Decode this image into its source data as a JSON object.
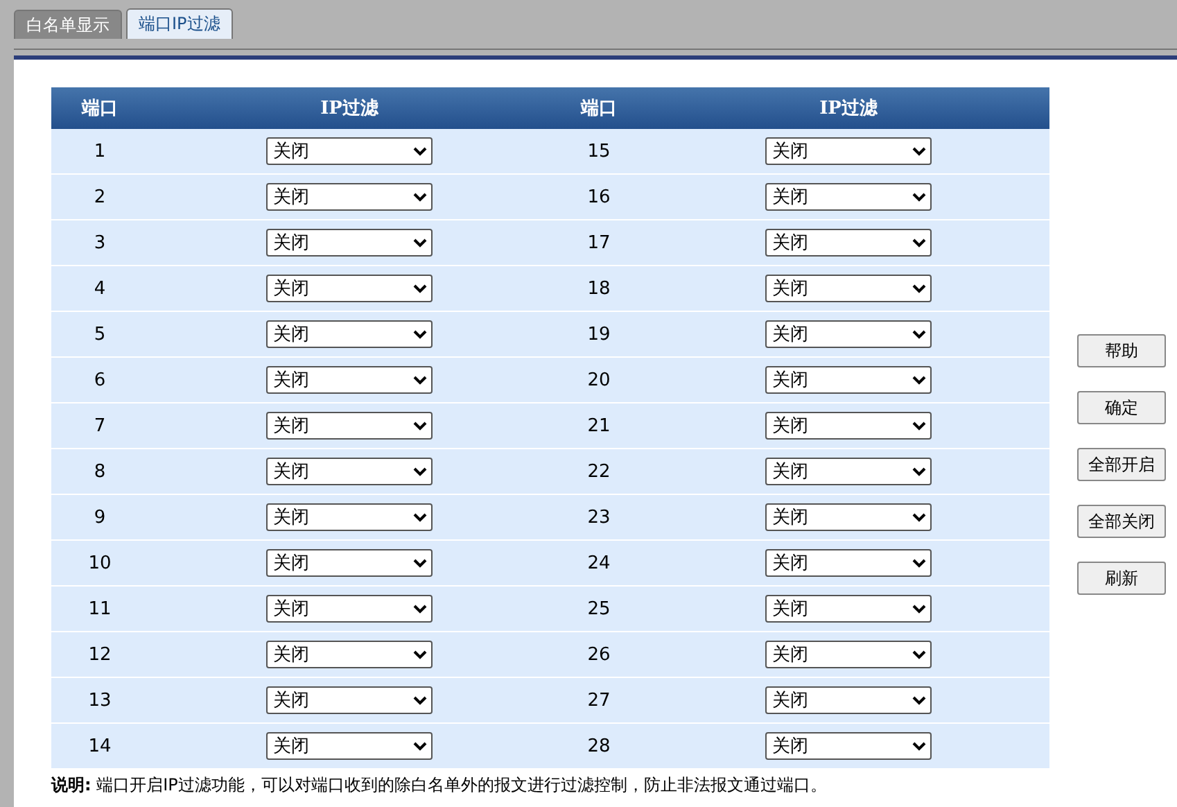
{
  "tabs": [
    {
      "label": "白名单显示",
      "selected": false
    },
    {
      "label": "端口IP过滤",
      "selected": true
    }
  ],
  "table": {
    "columns": [
      "端口",
      "IP过滤",
      "端口",
      "IP过滤"
    ],
    "rows": [
      {
        "port_a": "1",
        "filter_a": "关闭",
        "port_b": "15",
        "filter_b": "关闭"
      },
      {
        "port_a": "2",
        "filter_a": "关闭",
        "port_b": "16",
        "filter_b": "关闭"
      },
      {
        "port_a": "3",
        "filter_a": "关闭",
        "port_b": "17",
        "filter_b": "关闭"
      },
      {
        "port_a": "4",
        "filter_a": "关闭",
        "port_b": "18",
        "filter_b": "关闭"
      },
      {
        "port_a": "5",
        "filter_a": "关闭",
        "port_b": "19",
        "filter_b": "关闭"
      },
      {
        "port_a": "6",
        "filter_a": "关闭",
        "port_b": "20",
        "filter_b": "关闭"
      },
      {
        "port_a": "7",
        "filter_a": "关闭",
        "port_b": "21",
        "filter_b": "关闭"
      },
      {
        "port_a": "8",
        "filter_a": "关闭",
        "port_b": "22",
        "filter_b": "关闭"
      },
      {
        "port_a": "9",
        "filter_a": "关闭",
        "port_b": "23",
        "filter_b": "关闭"
      },
      {
        "port_a": "10",
        "filter_a": "关闭",
        "port_b": "24",
        "filter_b": "关闭"
      },
      {
        "port_a": "11",
        "filter_a": "关闭",
        "port_b": "25",
        "filter_b": "关闭"
      },
      {
        "port_a": "12",
        "filter_a": "关闭",
        "port_b": "26",
        "filter_b": "关闭"
      },
      {
        "port_a": "13",
        "filter_a": "关闭",
        "port_b": "27",
        "filter_b": "关闭"
      },
      {
        "port_a": "14",
        "filter_a": "关闭",
        "port_b": "28",
        "filter_b": "关闭"
      }
    ]
  },
  "note": "**说明:** 端口开启IP过滤功能，可以对端口收到的除白名单外的报文进行过滤控制，防止非法报文通过端口。",
  "buttons": [
    "帮助",
    "确定",
    "全部开启",
    "全部关闭",
    "刷新"
  ]
}
